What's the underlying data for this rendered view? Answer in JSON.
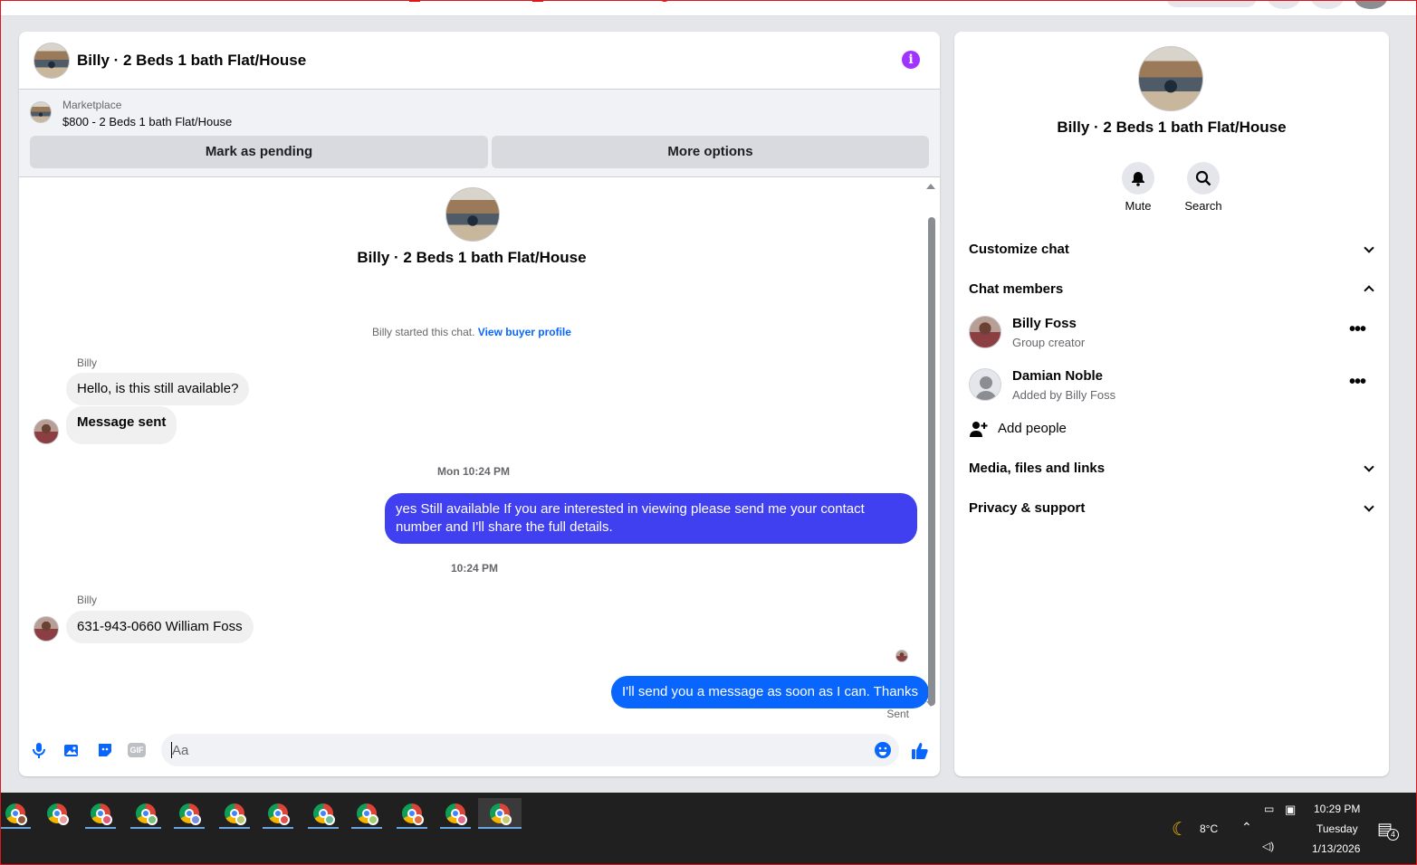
{
  "chat": {
    "title": "Billy · 2 Beds 1 bath Flat/House",
    "info_icon": "i",
    "marketplace": {
      "label": "Marketplace",
      "price": "$800 - 2 Beds 1 bath Flat/House"
    },
    "buttons": {
      "pending": "Mark as pending",
      "more": "More options"
    },
    "hero_title": "Billy · 2 Beds 1 bath Flat/House",
    "started_text": "Billy started this chat.",
    "view_profile": "View buyer profile",
    "messages": [
      {
        "sender": "Billy",
        "text": "Hello, is this still available?"
      },
      {
        "text": "Message sent"
      },
      {
        "time": "Mon 10:24 PM"
      },
      {
        "text": "yes Still available If you are interested in viewing please send me your contact number and I'll share the full details."
      },
      {
        "time": "10:24 PM"
      },
      {
        "sender": "Billy",
        "text": "631-943-0660 William Foss"
      },
      {
        "text": "I'll send you a message as soon as I can. Thanks"
      }
    ],
    "sent_label": "Sent",
    "composer_placeholder": "Aa",
    "composer_icons": [
      "microphone-icon",
      "image-icon",
      "sticker-icon",
      "gif-icon",
      "emoji-icon",
      "like-icon"
    ],
    "gif_label": "GIF"
  },
  "side": {
    "title": "Billy · 2 Beds 1 bath Flat/House",
    "mute": "Mute",
    "search": "Search",
    "customize": "Customize chat",
    "members": "Chat members",
    "member_list": [
      {
        "name": "Billy Foss",
        "sub": "Group creator"
      },
      {
        "name": "Damian Noble",
        "sub": "Added by Billy Foss"
      }
    ],
    "add_people": "Add people",
    "media": "Media, files and links",
    "privacy": "Privacy & support"
  },
  "taskbar": {
    "temperature": "8°C",
    "time": "10:29 PM",
    "day": "Tuesday",
    "date": "1/13/2026",
    "notifications": "4"
  },
  "colors": {
    "accent": "#0866ff",
    "outgoing": "#4040f0",
    "info": "#a033ff"
  }
}
